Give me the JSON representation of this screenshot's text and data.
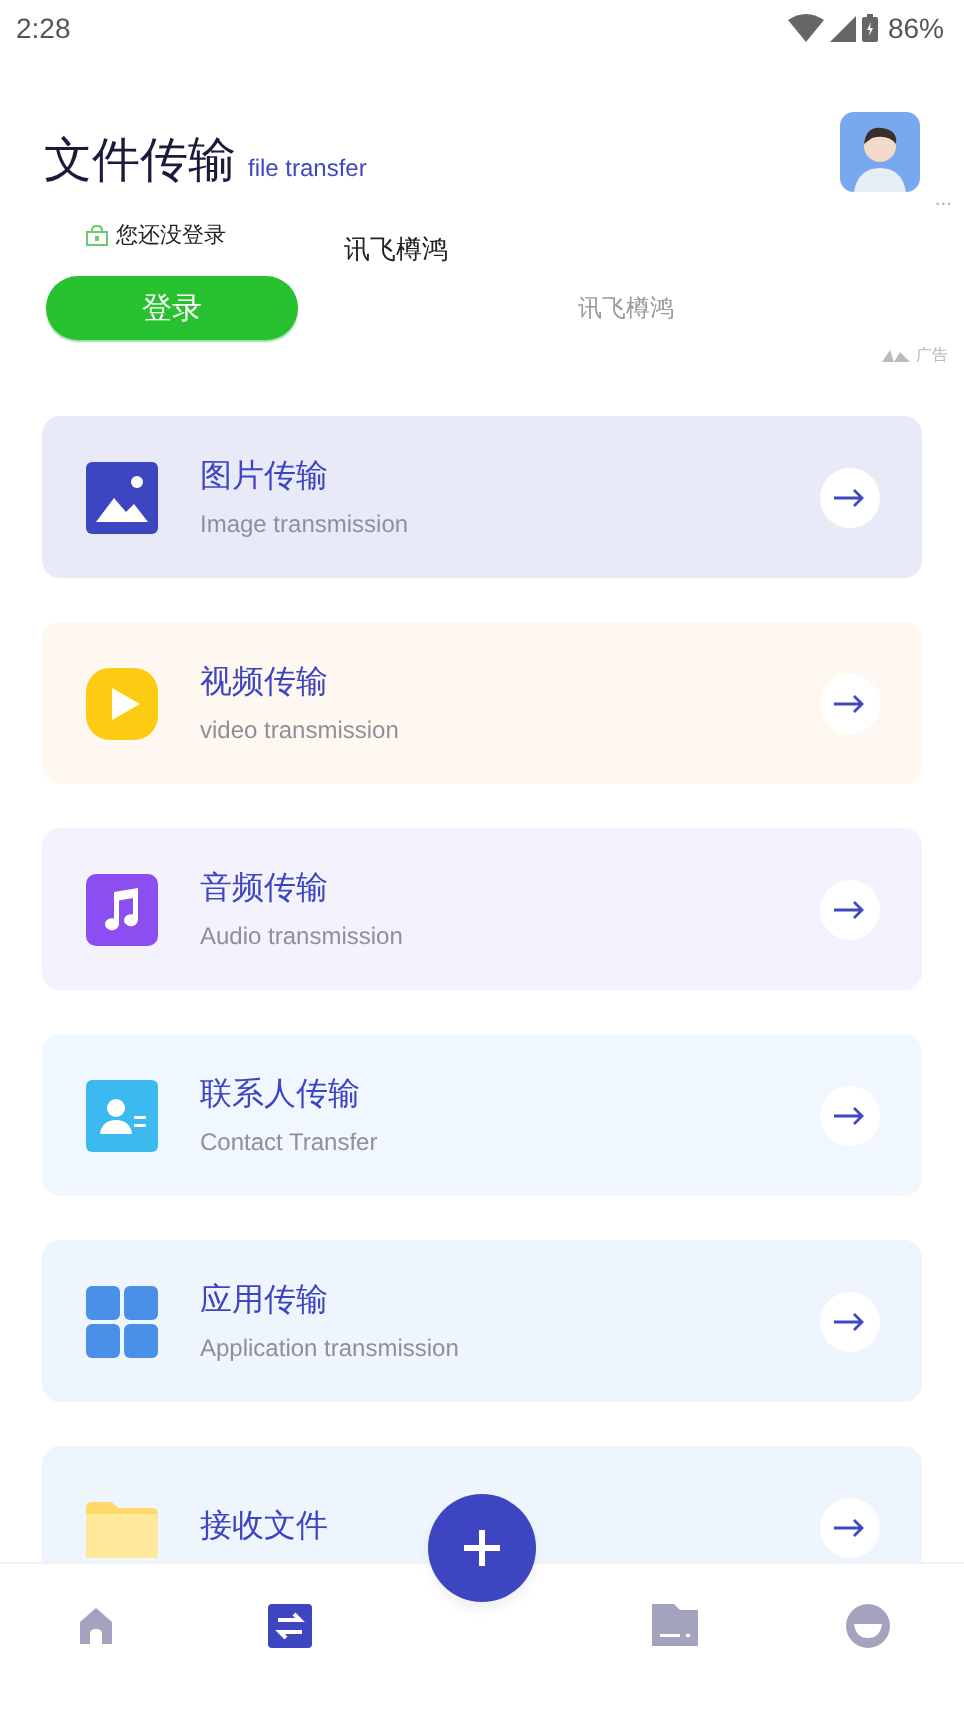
{
  "status_bar": {
    "time": "2:28",
    "battery": "86%"
  },
  "header": {
    "title": "文件传输",
    "subtitle": "file transfer"
  },
  "ad": {
    "more": "···",
    "notice": "您还没登录",
    "brand": "讯飞樽鸿",
    "login_button": "登录",
    "brand_caption": "讯飞樽鸿",
    "ad_label": "广告"
  },
  "cards": [
    {
      "kind": "image",
      "title": "图片传输",
      "subtitle": "Image transmission",
      "color": "#e9eaf7"
    },
    {
      "kind": "video",
      "title": "视频传输",
      "subtitle": "video transmission",
      "color": "#fff8f1"
    },
    {
      "kind": "audio",
      "title": "音频传输",
      "subtitle": "Audio transmission",
      "color": "#f4f2fd"
    },
    {
      "kind": "contact",
      "title": "联系人传输",
      "subtitle": "Contact Transfer",
      "color": "#f0f7fe"
    },
    {
      "kind": "apps",
      "title": "应用传输",
      "subtitle": "Application transmission",
      "color": "#eef5fd"
    },
    {
      "kind": "folder",
      "title": "接收文件",
      "color": "#eef5fd"
    }
  ],
  "nav": [
    {
      "kind": "home",
      "selected": false
    },
    {
      "kind": "transfer",
      "selected": true
    },
    {
      "kind": "files",
      "selected": false
    },
    {
      "kind": "profile",
      "selected": false
    }
  ]
}
